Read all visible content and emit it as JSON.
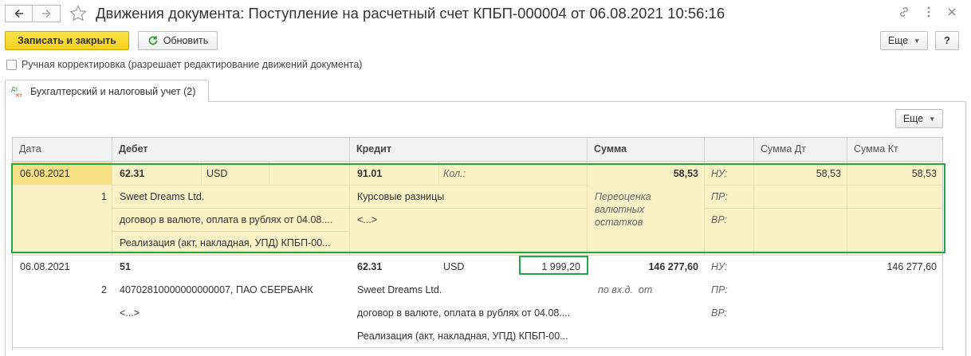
{
  "window": {
    "title": "Движения документа: Поступление на расчетный счет КПБП-000004 от 06.08.2021 10:56:16"
  },
  "toolbar": {
    "save_close_label": "Записать и закрыть",
    "refresh_label": "Обновить",
    "more_label": "Еще",
    "help_label": "?"
  },
  "manual_edit": {
    "label": "Ручная корректировка (разрешает редактирование движений документа)",
    "checked": false
  },
  "tab": {
    "label": "Бухгалтерский и налоговый учет (2)",
    "icon_top": "Дт",
    "icon_bottom": "Кт"
  },
  "table": {
    "more_label": "Еще",
    "columns": [
      "Дата",
      "Дебет",
      "Кредит",
      "Сумма",
      "",
      "Сумма Дт",
      "Сумма Кт"
    ],
    "rows": [
      {
        "date": "06.08.2021",
        "number": "1",
        "debit_account": "62.31",
        "debit_currency": "USD",
        "debit_sub1": "Sweet Dreams Ltd.",
        "debit_sub2": "договор в валюте, оплата в рублях от 04.08....",
        "debit_sub3": "Реализация (акт, накладная, УПД) КПБП-00...",
        "credit_account": "91.01",
        "credit_qty_label": "Кол.:",
        "credit_sub1": "Курсовые разницы",
        "credit_sub2": "<...>",
        "credit_sub3": "",
        "amount": "58,53",
        "content": "Переоценка валютных остатков",
        "nu_label": "НУ:",
        "pr_label": "ПР:",
        "vr_label": "ВР:",
        "sum_dt_nu": "58,53",
        "sum_kt_nu": "58,53"
      },
      {
        "date": "06.08.2021",
        "number": "2",
        "debit_account": "51",
        "debit_sub1": "40702810000000000007, ПАО СБЕРБАНК",
        "debit_sub2": "<...>",
        "credit_account": "62.31",
        "credit_currency": "USD",
        "credit_currency_amount": "1 999,20",
        "credit_sub1": "Sweet Dreams Ltd.",
        "credit_sub2": "договор в валюте, оплата в рублях от 04.08....",
        "credit_sub3": "Реализация (акт, накладная, УПД) КПБП-00...",
        "amount": "146 277,60",
        "content": "по вх.д.  от",
        "nu_label": "НУ:",
        "pr_label": "ПР:",
        "vr_label": "ВР:",
        "sum_kt_nu": "146 277,60"
      }
    ]
  },
  "colors": {
    "primary_button": "#f4cf19",
    "selected_row": "#fbf1c6",
    "selected_cell": "#f7df86",
    "highlight_border": "#1fa84a",
    "refresh_icon": "#2f9a2f"
  }
}
